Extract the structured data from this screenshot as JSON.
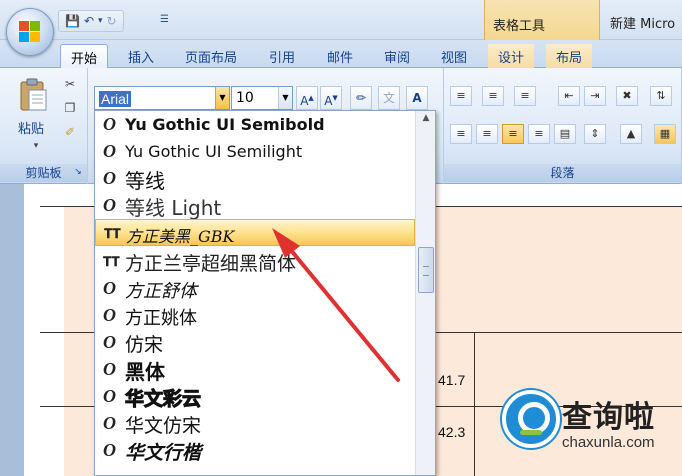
{
  "titlebar": {
    "context_tab_group": "表格工具",
    "document_title": "新建 Micro"
  },
  "ribbon_tabs": [
    {
      "label": "开始",
      "active": true
    },
    {
      "label": "插入"
    },
    {
      "label": "页面布局"
    },
    {
      "label": "引用"
    },
    {
      "label": "邮件"
    },
    {
      "label": "审阅"
    },
    {
      "label": "视图"
    },
    {
      "label": "设计",
      "contextual": true
    },
    {
      "label": "布局",
      "contextual": true
    }
  ],
  "clipboard": {
    "paste_label": "粘贴",
    "group_label": "剪贴板"
  },
  "font": {
    "current_font": "Arial",
    "current_size": "10"
  },
  "paragraph": {
    "group_label": "段落"
  },
  "font_list": [
    {
      "name": "Yu Gothic UI Semibold",
      "type": "opentype"
    },
    {
      "name": "Yu Gothic UI Semilight",
      "type": "opentype"
    },
    {
      "name": "等线",
      "type": "opentype"
    },
    {
      "name": "等线 Light",
      "type": "opentype"
    },
    {
      "name": "方正美黑_GBK",
      "type": "truetype",
      "highlighted": true
    },
    {
      "name": "方正兰亭超细黑简体",
      "type": "truetype"
    },
    {
      "name": "方正舒体",
      "type": "opentype"
    },
    {
      "name": "方正姚体",
      "type": "opentype"
    },
    {
      "name": "仿宋",
      "type": "opentype"
    },
    {
      "name": "黑体",
      "type": "opentype"
    },
    {
      "name": "华文彩云",
      "type": "opentype"
    },
    {
      "name": "华文仿宋",
      "type": "opentype"
    },
    {
      "name": "华文行楷",
      "type": "opentype"
    }
  ],
  "table_values": [
    "41.7",
    "42.3"
  ],
  "watermark": {
    "brand": "查询啦",
    "url": "chaxunla.com"
  },
  "colors": {
    "accent": "#15428b",
    "highlight": "#f7c653",
    "table_fill": "#fce9d9",
    "arrow": "#e03131"
  }
}
